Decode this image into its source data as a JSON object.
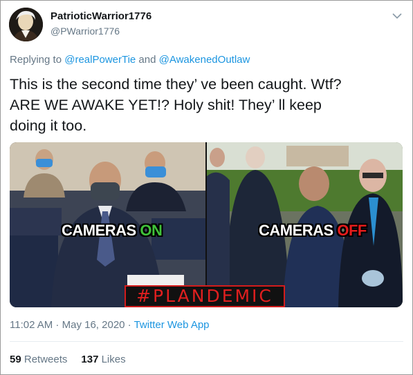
{
  "author": {
    "display_name": "PatrioticWarrior1776",
    "handle": "@PWarrior1776"
  },
  "reply": {
    "prefix": "Replying to ",
    "mention1": "@realPowerTie",
    "joiner": " and ",
    "mention2": "@AwakenedOutlaw"
  },
  "tweet": {
    "line1": "This is the second time they’ ve been caught. Wtf?",
    "line2": "ARE WE AWAKE YET!? Holy shit! They’ ll keep",
    "line3": "doing it too."
  },
  "media": {
    "caption_left_prefix": "CAMERAS ",
    "caption_left_word": "ON",
    "caption_right_prefix": "CAMERAS ",
    "caption_right_word": "OFF",
    "hashtag": "#PLANDEMIC"
  },
  "meta": {
    "time": "11:02 AM",
    "sep1": " · ",
    "date": "May 16, 2020",
    "sep2": " · ",
    "source": "Twitter Web App"
  },
  "stats": {
    "retweets_count": "59",
    "retweets_label": "Retweets",
    "likes_count": "137",
    "likes_label": "Likes"
  },
  "icons": {
    "caret": "chevron-down-icon",
    "avatar": "avatar-portrait"
  },
  "colors": {
    "link": "#1b95e0",
    "muted": "#657786",
    "text": "#14171a",
    "on_green": "#40c23a",
    "off_red": "#e51c1c"
  }
}
